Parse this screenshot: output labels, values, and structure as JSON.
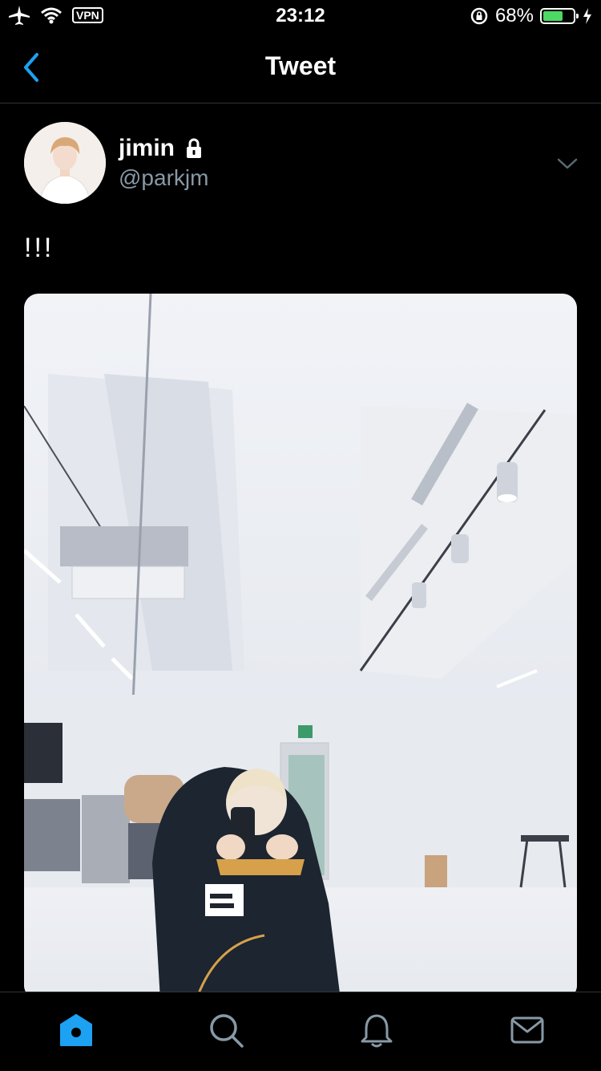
{
  "status_bar": {
    "vpn": "VPN",
    "time": "23:12",
    "battery_percent": "68%",
    "battery_level": 0.68,
    "icons": [
      "airplane-icon",
      "wifi-icon",
      "rotation-lock-icon",
      "battery-icon",
      "charging-icon"
    ]
  },
  "nav": {
    "title": "Tweet",
    "back_icon": "chevron-left-icon"
  },
  "tweet": {
    "author": {
      "name": "jimin",
      "handle": "@parkjm",
      "protected_icon": "lock-icon"
    },
    "text": "!!!",
    "media": {
      "type": "photo",
      "icon": "photo"
    }
  },
  "tab_bar": {
    "items": [
      {
        "name": "home",
        "icon": "home-icon",
        "active": true
      },
      {
        "name": "search",
        "icon": "search-icon",
        "active": false
      },
      {
        "name": "notifications",
        "icon": "bell-icon",
        "active": false
      },
      {
        "name": "messages",
        "icon": "mail-icon",
        "active": false
      }
    ]
  },
  "colors": {
    "background": "#000000",
    "accent": "#1da1f2",
    "secondary_text": "#8899a6",
    "battery": "#4cd964",
    "divider": "#2f3336"
  }
}
